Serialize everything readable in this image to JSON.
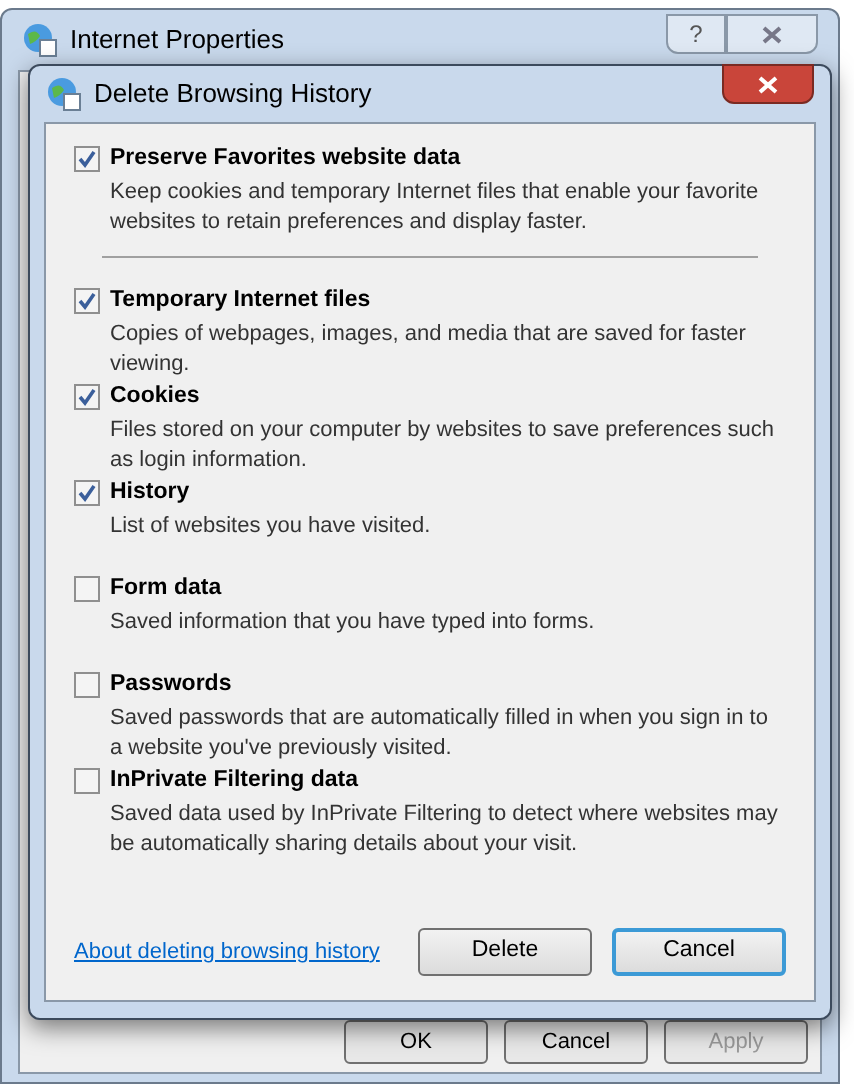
{
  "window": {
    "title": "Internet Properties",
    "help_button": "?",
    "buttons": [
      {
        "label": "OK",
        "disabled": false
      },
      {
        "label": "Cancel",
        "disabled": false
      },
      {
        "label": "Apply",
        "disabled": true
      }
    ]
  },
  "dialog": {
    "title": "Delete Browsing History",
    "options": [
      {
        "label": "Preserve Favorites website data",
        "description": "Keep cookies and temporary Internet files that enable your favorite websites to retain preferences and display faster.",
        "checked": true
      },
      {
        "label": "Temporary Internet files",
        "description": "Copies of webpages, images, and media that are saved for faster viewing.",
        "checked": true
      },
      {
        "label": "Cookies",
        "description": "Files stored on your computer by websites to save preferences such as login information.",
        "checked": true
      },
      {
        "label": "History",
        "description": "List of websites you have visited.",
        "checked": true
      },
      {
        "label": "Form data",
        "description": "Saved information that you have typed into forms.",
        "checked": false
      },
      {
        "label": "Passwords",
        "description": "Saved passwords that are automatically filled in when you sign in to a website you've previously visited.",
        "checked": false
      },
      {
        "label": "InPrivate Filtering data",
        "description": "Saved data used by InPrivate Filtering to detect where websites may be automatically sharing details about your visit.",
        "checked": false
      }
    ],
    "link": "About deleting browsing history",
    "buttons": [
      {
        "label": "Delete",
        "default": false
      },
      {
        "label": "Cancel",
        "default": true
      }
    ]
  }
}
